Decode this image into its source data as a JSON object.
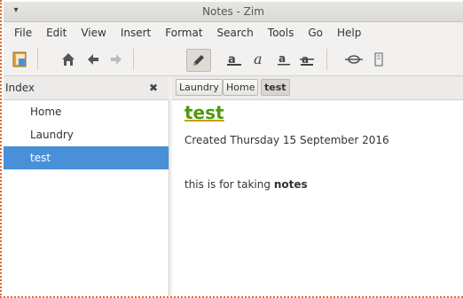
{
  "window": {
    "title": "Notes - Zim",
    "menu_glyph": "▾"
  },
  "menubar": {
    "items": [
      "File",
      "Edit",
      "View",
      "Insert",
      "Format",
      "Search",
      "Tools",
      "Go",
      "Help"
    ]
  },
  "toolbar": {
    "buttons": [
      "notebook-icon",
      "home-icon",
      "back-arrow-icon",
      "forward-arrow-icon",
      "edit-pencil-icon",
      "bold-icon",
      "italic-icon",
      "underline-icon",
      "strike-icon",
      "link-icon",
      "attachment-icon"
    ]
  },
  "index": {
    "title": "Index",
    "close_glyph": "✖",
    "items": [
      {
        "label": "Home",
        "selected": false
      },
      {
        "label": "Laundry",
        "selected": false
      },
      {
        "label": "test",
        "selected": true
      }
    ]
  },
  "pathbar": {
    "crumbs": [
      {
        "label": "Laundry",
        "active": false
      },
      {
        "label": "Home",
        "active": false
      },
      {
        "label": "test",
        "active": true
      }
    ]
  },
  "page": {
    "title": "test",
    "created": "Created Thursday 15 September 2016",
    "body_prefix": "this is for taking ",
    "body_bold": "notes"
  },
  "colors": {
    "selection": "#4a90d9",
    "title_link": "#4e9a06"
  }
}
